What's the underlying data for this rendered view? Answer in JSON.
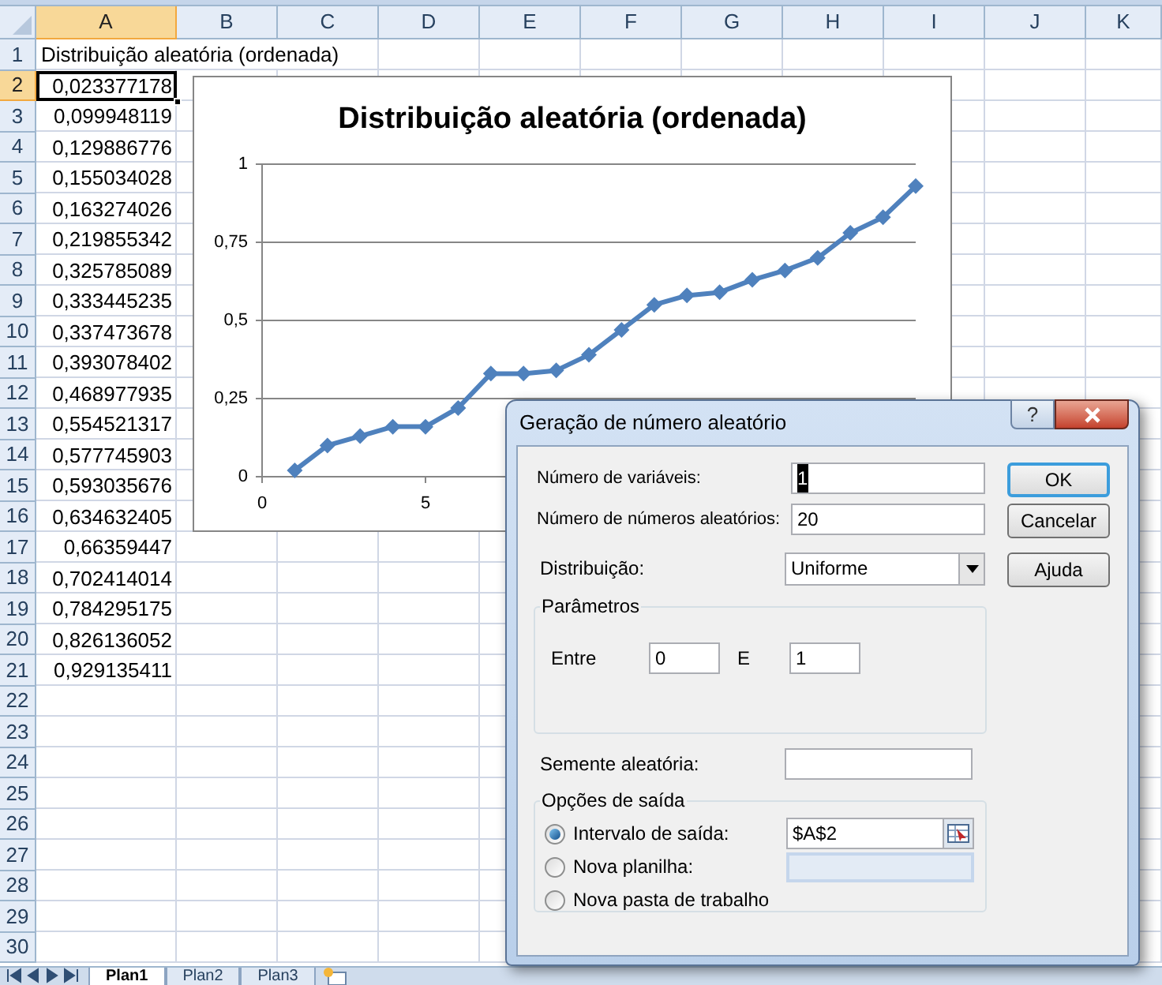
{
  "columns": [
    {
      "label": "A",
      "selected": true
    },
    {
      "label": "B",
      "selected": false
    },
    {
      "label": "C",
      "selected": false
    },
    {
      "label": "D",
      "selected": false
    },
    {
      "label": "E",
      "selected": false
    },
    {
      "label": "F",
      "selected": false
    },
    {
      "label": "G",
      "selected": false
    },
    {
      "label": "H",
      "selected": false
    },
    {
      "label": "I",
      "selected": false
    },
    {
      "label": "J",
      "selected": false
    },
    {
      "label": "K",
      "selected": false
    }
  ],
  "rows": [
    {
      "number": "1",
      "selected": false,
      "cell": {
        "kind": "text",
        "value": "Distribuição aleatória (ordenada)"
      }
    },
    {
      "number": "2",
      "selected": true,
      "cell": {
        "kind": "number",
        "value": "0,023377178"
      }
    },
    {
      "number": "3",
      "selected": false,
      "cell": {
        "kind": "number",
        "value": "0,099948119"
      }
    },
    {
      "number": "4",
      "selected": false,
      "cell": {
        "kind": "number",
        "value": "0,129886776"
      }
    },
    {
      "number": "5",
      "selected": false,
      "cell": {
        "kind": "number",
        "value": "0,155034028"
      }
    },
    {
      "number": "6",
      "selected": false,
      "cell": {
        "kind": "number",
        "value": "0,163274026"
      }
    },
    {
      "number": "7",
      "selected": false,
      "cell": {
        "kind": "number",
        "value": "0,219855342"
      }
    },
    {
      "number": "8",
      "selected": false,
      "cell": {
        "kind": "number",
        "value": "0,325785089"
      }
    },
    {
      "number": "9",
      "selected": false,
      "cell": {
        "kind": "number",
        "value": "0,333445235"
      }
    },
    {
      "number": "10",
      "selected": false,
      "cell": {
        "kind": "number",
        "value": "0,337473678"
      }
    },
    {
      "number": "11",
      "selected": false,
      "cell": {
        "kind": "number",
        "value": "0,393078402"
      }
    },
    {
      "number": "12",
      "selected": false,
      "cell": {
        "kind": "number",
        "value": "0,468977935"
      }
    },
    {
      "number": "13",
      "selected": false,
      "cell": {
        "kind": "number",
        "value": "0,554521317"
      }
    },
    {
      "number": "14",
      "selected": false,
      "cell": {
        "kind": "number",
        "value": "0,577745903"
      }
    },
    {
      "number": "15",
      "selected": false,
      "cell": {
        "kind": "number",
        "value": "0,593035676"
      }
    },
    {
      "number": "16",
      "selected": false,
      "cell": {
        "kind": "number",
        "value": "0,634632405"
      }
    },
    {
      "number": "17",
      "selected": false,
      "cell": {
        "kind": "number",
        "value": "0,66359447"
      }
    },
    {
      "number": "18",
      "selected": false,
      "cell": {
        "kind": "number",
        "value": "0,702414014"
      }
    },
    {
      "number": "19",
      "selected": false,
      "cell": {
        "kind": "number",
        "value": "0,784295175"
      }
    },
    {
      "number": "20",
      "selected": false,
      "cell": {
        "kind": "number",
        "value": "0,826136052"
      }
    },
    {
      "number": "21",
      "selected": false,
      "cell": {
        "kind": "number",
        "value": "0,929135411"
      }
    },
    {
      "number": "22",
      "selected": false
    },
    {
      "number": "23",
      "selected": false
    },
    {
      "number": "24",
      "selected": false
    },
    {
      "number": "25",
      "selected": false
    },
    {
      "number": "26",
      "selected": false
    },
    {
      "number": "27",
      "selected": false
    },
    {
      "number": "28",
      "selected": false
    },
    {
      "number": "29",
      "selected": false
    },
    {
      "number": "30",
      "selected": false
    }
  ],
  "chart": {
    "chart_data": {
      "type": "line",
      "title": "Distribuição aleatória (ordenada)",
      "x": [
        1,
        2,
        3,
        4,
        5,
        6,
        7,
        8,
        9,
        10,
        11,
        12,
        13,
        14,
        15,
        16,
        17,
        18,
        19,
        20
      ],
      "series": [
        {
          "color": "#4f81bd",
          "marker": "diamond",
          "values": [
            0.02,
            0.1,
            0.13,
            0.16,
            0.16,
            0.22,
            0.33,
            0.33,
            0.34,
            0.39,
            0.47,
            0.55,
            0.58,
            0.59,
            0.63,
            0.66,
            0.7,
            0.78,
            0.83,
            0.93
          ]
        }
      ],
      "grid": true,
      "xlim": [
        0,
        20
      ],
      "ylim": [
        0,
        1
      ],
      "xticks": [
        0,
        5
      ],
      "yticks": [
        {
          "value": 0,
          "label": "0"
        },
        {
          "value": 0.25,
          "label": "0,25"
        },
        {
          "value": 0.5,
          "label": "0,5"
        },
        {
          "value": 0.75,
          "label": "0,75"
        },
        {
          "value": 1,
          "label": "1"
        }
      ]
    }
  },
  "sheet_tabs": [
    {
      "label": "Plan1",
      "selected": true
    },
    {
      "label": "Plan2",
      "selected": false
    },
    {
      "label": "Plan3",
      "selected": false
    }
  ],
  "dialog": {
    "title": "Geração de número aleatório",
    "help_button": "?",
    "fields": [
      {
        "label": "Número de variáveis:",
        "value": "1",
        "text_selected": true
      },
      {
        "label": "Número de números aleatórios:",
        "value": "20",
        "text_selected": false
      }
    ],
    "distribution": {
      "label": "Distribuição:",
      "value": "Uniforme"
    },
    "buttons": [
      {
        "label": "OK",
        "default": true
      },
      {
        "label": "Cancelar",
        "default": false
      },
      {
        "label": "Ajuda",
        "default": false
      }
    ],
    "parameters": {
      "title": "Parâmetros",
      "from_label": "Entre",
      "from": "0",
      "to_label": "E",
      "to": "1"
    },
    "seed": {
      "label": "Semente aleatória:"
    },
    "output": {
      "title": "Opções de saída",
      "options": [
        {
          "label": "Intervalo de saída:",
          "selected": true,
          "field": {
            "value": "$A$2",
            "disabled": false
          }
        },
        {
          "label": "Nova planilha:",
          "selected": false,
          "field": {
            "disabled": true
          }
        },
        {
          "label": "Nova pasta de trabalho",
          "selected": false
        }
      ]
    }
  }
}
